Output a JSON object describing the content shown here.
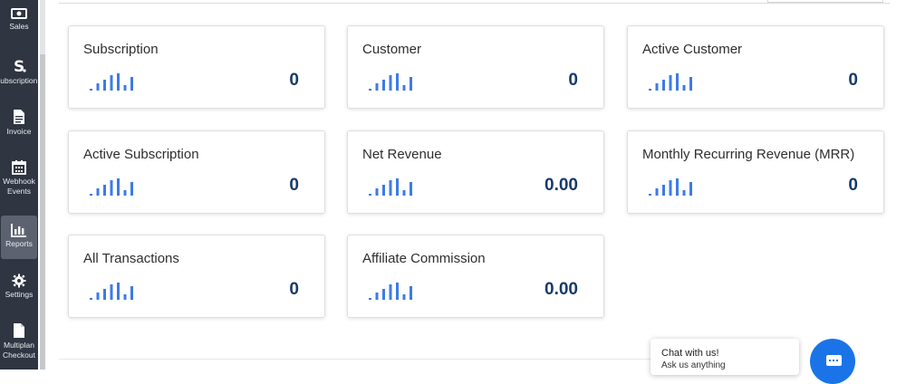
{
  "sidebar": {
    "items": [
      {
        "label": "Sales",
        "icon": "money-icon"
      },
      {
        "label": "Subscription",
        "icon": "subscription-s-icon"
      },
      {
        "label": "Invoice",
        "icon": "document-icon"
      },
      {
        "label": "Webhook Events",
        "icon": "calendar-icon"
      },
      {
        "label": "Reports",
        "icon": "bar-chart-icon",
        "active": true
      },
      {
        "label": "Settings",
        "icon": "gear-icon"
      },
      {
        "label": "Multiplan Checkout",
        "icon": "file-icon"
      }
    ]
  },
  "cards": [
    {
      "title": "Subscription",
      "value": "0"
    },
    {
      "title": "Customer",
      "value": "0"
    },
    {
      "title": "Active Customer",
      "value": "0"
    },
    {
      "title": "Active Subscription",
      "value": "0"
    },
    {
      "title": "Net Revenue",
      "value": "0.00"
    },
    {
      "title": "Monthly Recurring Revenue (MRR)",
      "value": "0"
    },
    {
      "title": "All Transactions",
      "value": "0"
    },
    {
      "title": "Affiliate Commission",
      "value": "0.00"
    }
  ],
  "chat": {
    "title": "Chat with us!",
    "subtitle": "Ask us anything"
  },
  "colors": {
    "sidebar": "#2f3541",
    "accent": "#3d7be6",
    "value_text": "#173a6a",
    "chat_button": "#1a74e8"
  }
}
